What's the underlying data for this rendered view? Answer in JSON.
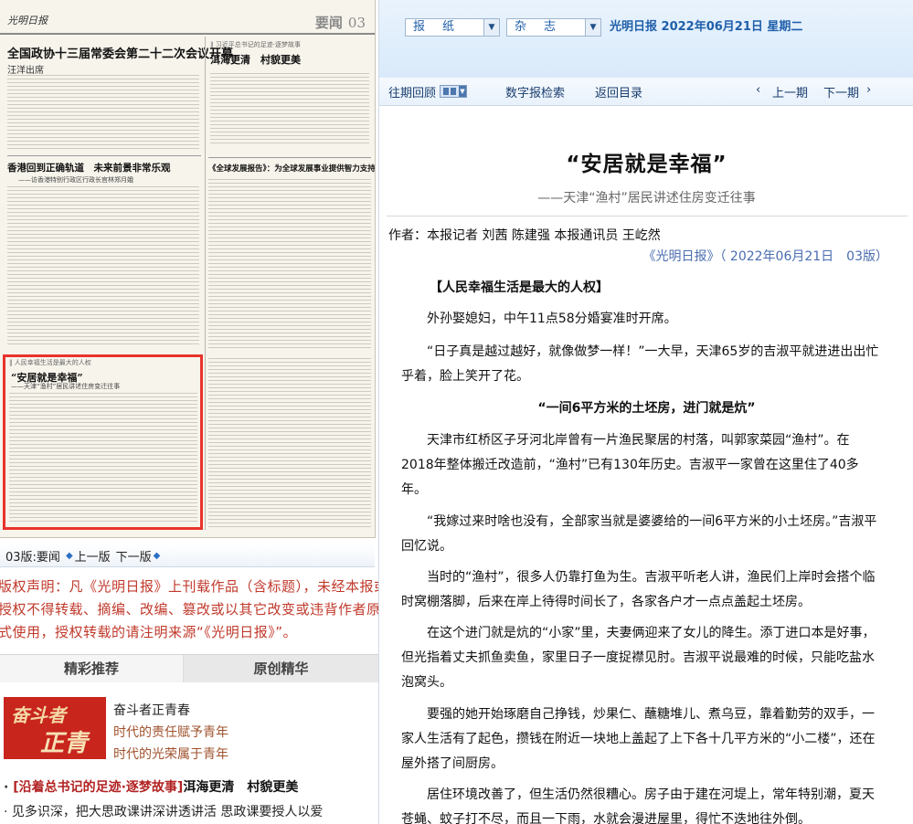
{
  "newspaper": {
    "logo": "光明日报",
    "page_label_name": "要闻",
    "page_label_num": "03",
    "headlines": {
      "main": "全国政协十三届常委会第二十二次会议开幕",
      "main_byline": "汪洋出席",
      "hk": "香港回到正确轨道　未来前景非常乐观",
      "hk_sub": "——访香港特别行政区行政长官林郑月娥",
      "right_tag": "‖ 习近平总书记的足迹·逐梦故事",
      "right": "洱海更清　村貌更美",
      "dev": "《全球发展报告》：为全球发展事业提供智力支持",
      "box_tag": "‖ 人民幸福生活是最大的人权",
      "box_title": "“安居就是幸福”",
      "box_sub": "——天津“渔村”居民讲述住房变迁往事"
    }
  },
  "pager": {
    "current": "03版:要闻",
    "prev": "上一版",
    "next": "下一版"
  },
  "copyright": {
    "line1": "版权声明：凡《光明日报》上刊载作品（含标题），未经本报或本网",
    "line2": "授权不得转载、摘编、改编、篡改或以其它改变或违背作者原意的方",
    "line3": "式使用，授权转载的请注明来源“《光明日报》”。"
  },
  "tabs": [
    "精彩推荐",
    "原创精华"
  ],
  "featured": {
    "image_text_1": "奋斗者",
    "image_text_2": "正青春",
    "title": "奋斗者正青春",
    "sub1": "时代的责任赋予青年",
    "sub2": "时代的光荣属于青年"
  },
  "news": [
    {
      "bullet": "·",
      "tag": "[沿着总书记的足迹·逐梦故事]",
      "rest": "洱海更清　村貌更美"
    },
    {
      "bullet": "·",
      "text": "见多识深，把大思政课讲深讲透讲活 思政课要授人以爱"
    }
  ],
  "toolbar": {
    "select_paper": "报　纸",
    "select_magazine": "杂　志",
    "pub_date": "光明日报 2022年06月21日 星期二",
    "nav": {
      "past": "往期回顾",
      "search": "数字报检索",
      "back": "返回目录",
      "prev_issue": "上一期",
      "next_issue": "下一期"
    }
  },
  "article": {
    "title": "“安居就是幸福”",
    "subtitle": "——天津“渔村”居民讲述住房变迁往事",
    "author": "作者：本报记者 刘茜 陈建强 本报通讯员 王屹然",
    "source": "《光明日报》（ 2022年06月21日　03版）",
    "section1": "【人民幸福生活是最大的人权】",
    "p1": "外孙娶媳妇，中午11点58分婚宴准时开席。",
    "p2": "“日子真是越过越好，就像做梦一样！”一大早，天津65岁的吉淑平就进进出出忙乎着，脸上笑开了花。",
    "section2": "“一间6平方米的土坯房，进门就是炕”",
    "p3": "天津市红桥区子牙河北岸曾有一片渔民聚居的村落，叫郭家菜园“渔村”。在2018年整体搬迁改造前，“渔村”已有130年历史。吉淑平一家曾在这里住了40多年。",
    "p4": "“我嫁过来时啥也没有，全部家当就是婆婆给的一间6平方米的小土坯房。”吉淑平回忆说。",
    "p5": "当时的“渔村”，很多人仍靠打鱼为生。吉淑平听老人讲，渔民们上岸时会搭个临时窝棚落脚，后来在岸上待得时间长了，各家各户才一点点盖起土坯房。",
    "p6": "在这个进门就是炕的“小家”里，夫妻俩迎来了女儿的降生。添丁进口本是好事，但光指着丈夫抓鱼卖鱼，家里日子一度捉襟见肘。吉淑平说最难的时候，只能吃盐水泡窝头。",
    "p7": "要强的她开始琢磨自己挣钱，炒果仁、蘸糖堆儿、煮乌豆，靠着勤劳的双手，一家人生活有了起色，攒钱在附近一块地上盖起了上下各十几平方米的“小二楼”，还在屋外搭了间厨房。",
    "p8": "居住环境改善了，但生活仍然很糟心。房子由于建在河堤上，常年特别潮，夏天苍蝇、蚊子打不尽，而且一下雨，水就会漫进屋里，得忙不迭地往外倒。"
  }
}
